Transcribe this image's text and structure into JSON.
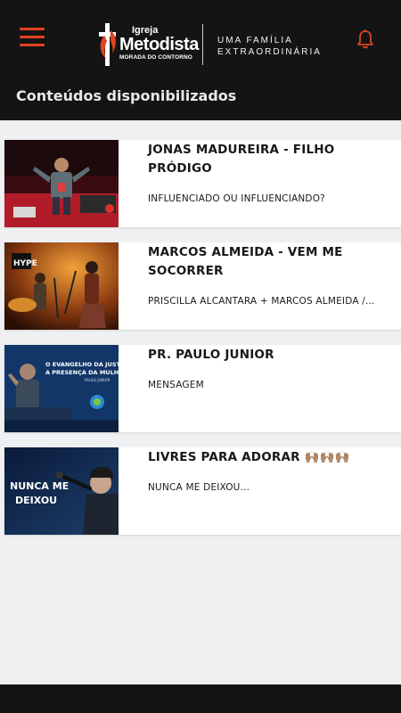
{
  "header": {
    "logo": {
      "line1": "Igreja",
      "line2": "Metodista",
      "line3": "MORADA DO CONTORNO"
    },
    "tagline": [
      "UMA FAMÍLIA",
      "EXTRAORDINÁRIA"
    ],
    "menu_icon": "hamburger-menu-icon",
    "notification_icon": "bell-icon",
    "accent_color": "#e0431f",
    "background_color": "#141414"
  },
  "section_title": "Conteúdos disponibilizados",
  "contents": [
    {
      "title": "JONAS MADUREIRA - FILHO PRÓDIGO",
      "subtitle": "INFLUENCIADO OU INFLUENCIANDO?"
    },
    {
      "title": "MARCOS ALMEIDA - VEM ME SOCORRER",
      "subtitle": "PRISCILLA ALCANTARA + MARCOS ALMEIDA /...",
      "thumbnail_text": "HYPE"
    },
    {
      "title": "PR. PAULO JUNIOR",
      "subtitle": "MENSAGEM",
      "thumbnail_text": [
        "O EVANGELHO DA JUSTIÇA E",
        "A PRESENÇA DA MULHER",
        "PAULO JUNIOR"
      ]
    },
    {
      "title": "LIVRES PARA ADORAR 🙌🏽🙌🏽🙌🏽",
      "subtitle": "NUNCA ME DEIXOU...",
      "thumbnail_text": [
        "NUNCA ME",
        "DEIXOU"
      ]
    }
  ]
}
